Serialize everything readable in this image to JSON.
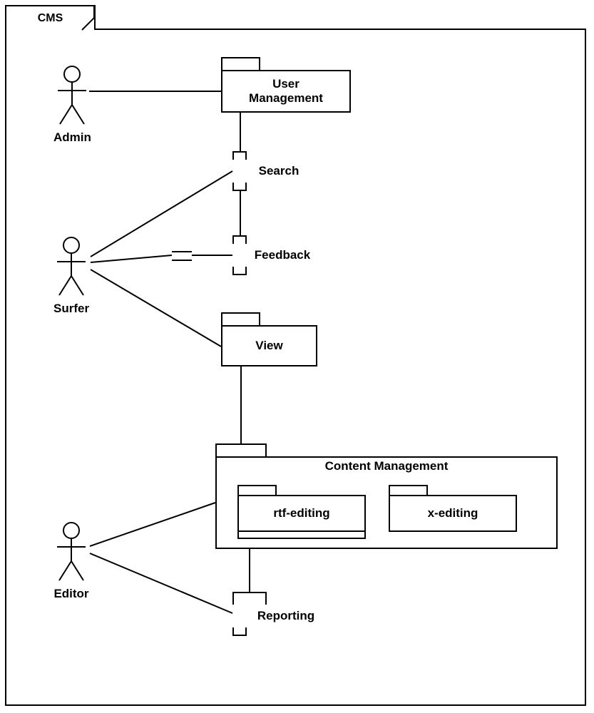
{
  "system": {
    "title": "CMS"
  },
  "actors": {
    "admin": "Admin",
    "surfer": "Surfer",
    "editor": "Editor"
  },
  "usecases": {
    "user_management": "User\nManagement",
    "search": "Search",
    "feedback": "Feedback",
    "view": "View",
    "content_management": "Content Management",
    "rtf_editing": "rtf-editing",
    "x_editing": "x-editing",
    "reporting": "Reporting"
  }
}
